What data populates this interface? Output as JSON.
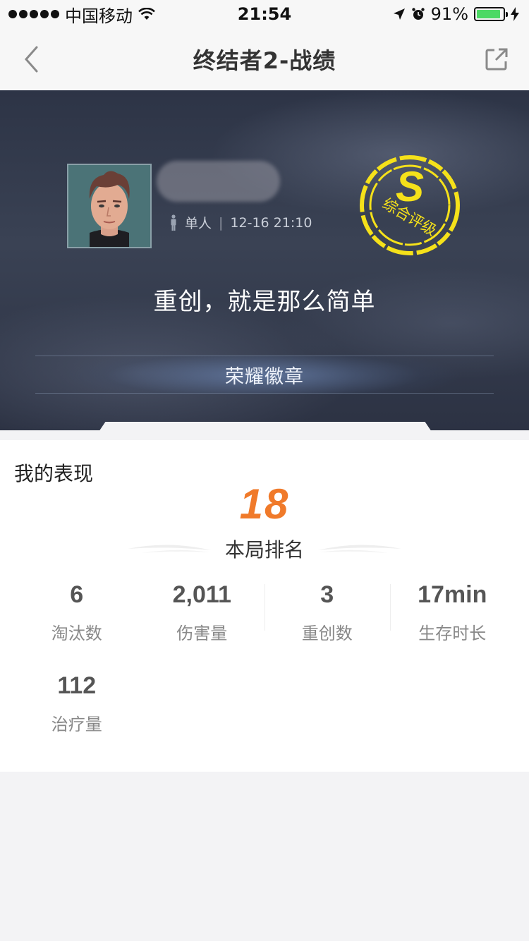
{
  "status_bar": {
    "carrier": "中国移动",
    "time": "21:54",
    "battery_percent": "91%",
    "battery_level": 0.91
  },
  "nav": {
    "title": "终结者2-战绩",
    "back_icon": "chevron-left-icon",
    "share_icon": "share-external-icon"
  },
  "hero": {
    "mode": "单人",
    "match_time": "12-16 21:10",
    "rating_letter": "S",
    "rating_label": "综合评级",
    "slogan": "重创，就是那么简单",
    "honor_label": "荣耀徽章",
    "rating_color": "#f5e11a"
  },
  "performance": {
    "title": "我的表现",
    "rank": "18",
    "rank_label": "本局排名",
    "rank_color": "#f07a2a",
    "stats": [
      {
        "value": "6",
        "label": "淘汰数"
      },
      {
        "value": "2,011",
        "label": "伤害量"
      },
      {
        "value": "3",
        "label": "重创数"
      },
      {
        "value": "17min",
        "label": "生存时长"
      },
      {
        "value": "112",
        "label": "治疗量"
      }
    ]
  }
}
